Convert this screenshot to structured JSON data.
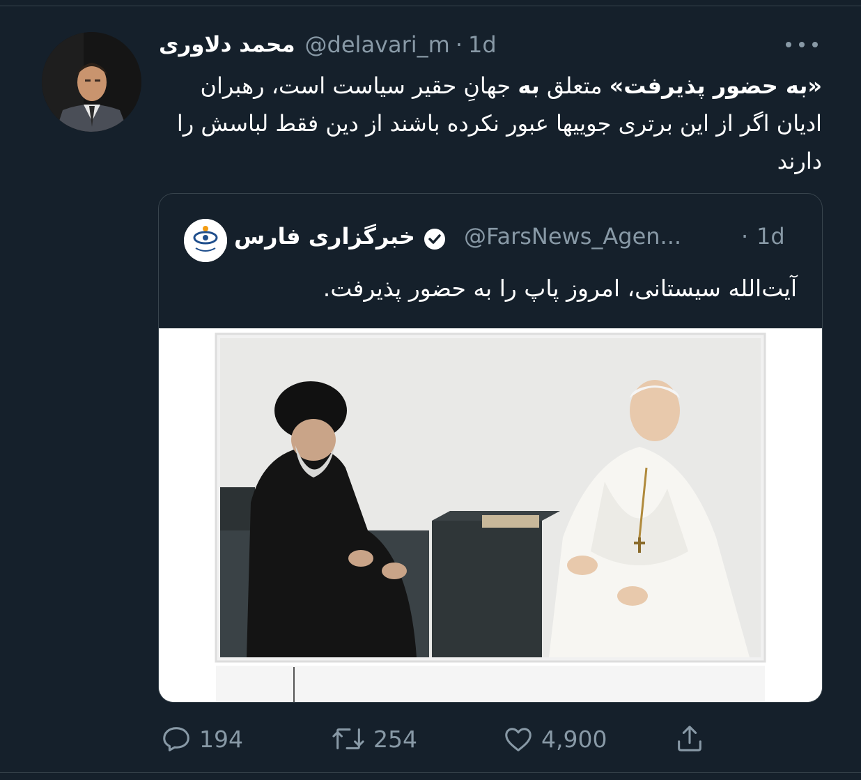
{
  "author": {
    "display_name": "محمد دلاوری",
    "handle": "@delavari_m",
    "time": "1d"
  },
  "tweet": {
    "bold1": "«به حضور پذیرفت»",
    "mid1": " متعلق ",
    "bold2": "به",
    "rest": " جهانِ حقیر سیاست است، رهبران ادیان اگر از این برتری جوییها عبور نکرده باشند از دین فقط لباسش را دارند"
  },
  "quoted": {
    "display_name": "خبرگزاری فارس",
    "handle": "@FarsNews_Agen...",
    "time": "1d",
    "text": "آیت‌الله سیستانی، امروز پاپ را به حضور پذیرفت."
  },
  "actions": {
    "replies": "194",
    "retweets": "254",
    "likes": "4,900"
  },
  "icons": [
    "more-icon",
    "verified-icon",
    "reply-icon",
    "retweet-icon",
    "like-icon",
    "share-icon"
  ],
  "colors": {
    "background": "#15202b",
    "text": "#ffffff",
    "secondary": "#8899a6",
    "border": "#38444d"
  }
}
